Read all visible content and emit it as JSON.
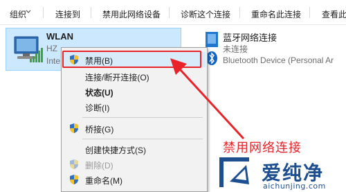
{
  "toolbar": {
    "items": [
      "组织",
      "连接到",
      "禁用此网络设备",
      "诊断这个连接",
      "重命名此连接",
      "查看此"
    ]
  },
  "adapters": {
    "wlan": {
      "name": "WLAN",
      "line1": "HZ",
      "line2": "Inte",
      "selected": true
    },
    "bluetooth": {
      "name": "蓝牙网络连接",
      "status": "未连接",
      "device": "Bluetooth Device (Personal Ar"
    }
  },
  "menu": {
    "items": [
      {
        "label": "禁用(B)",
        "shield": true,
        "bold": false,
        "disabled": false,
        "highlighted": true
      },
      {
        "label": "连接/断开连接(O)",
        "shield": false,
        "bold": false,
        "disabled": false
      },
      {
        "label": "状态(U)",
        "shield": false,
        "bold": true,
        "disabled": false
      },
      {
        "label": "诊断(I)",
        "shield": false,
        "bold": false,
        "disabled": false
      },
      {
        "label": "桥接(G)",
        "shield": true,
        "bold": false,
        "disabled": false
      },
      {
        "label": "创建快捷方式(S)",
        "shield": false,
        "bold": false,
        "disabled": false
      },
      {
        "label": "删除(D)",
        "shield": true,
        "bold": false,
        "disabled": true
      },
      {
        "label": "重命名(M)",
        "shield": true,
        "bold": false,
        "disabled": false
      }
    ]
  },
  "annotation": {
    "text": "禁用网络连接",
    "color": "#e8232a"
  },
  "watermark": {
    "brand": "爱纯净",
    "url": "aichunjing.com"
  },
  "colors": {
    "selection": "#cce8ff",
    "menu_bg": "#f2f2f2",
    "accent_red": "#e8232a",
    "brand_blue": "#1d4f90"
  }
}
